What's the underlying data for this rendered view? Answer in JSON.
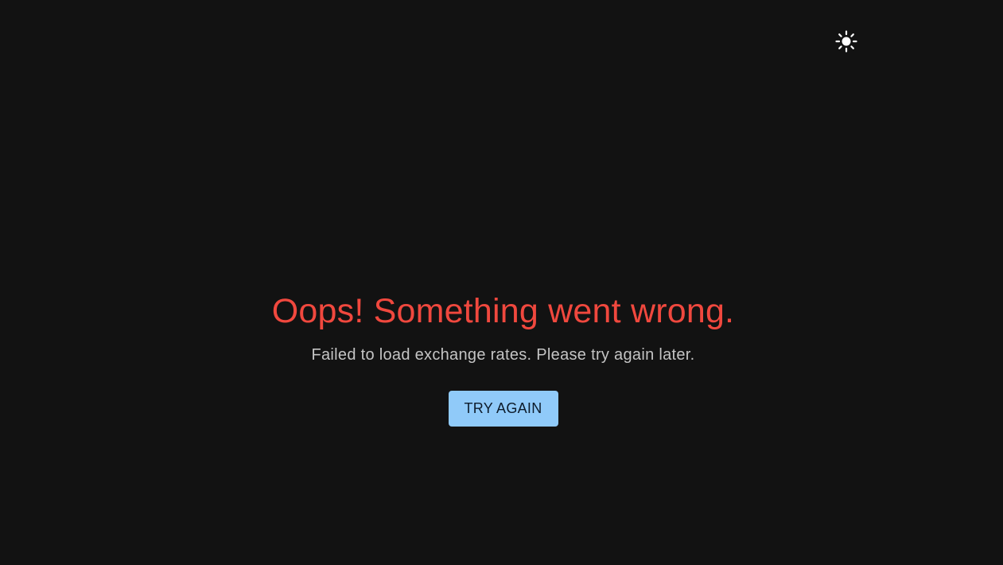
{
  "header": {
    "theme_toggle": {
      "icon": "sun-icon",
      "color": "#ffffff"
    }
  },
  "error": {
    "title": "Oops! Something went wrong.",
    "message": "Failed to load exchange rates. Please try again later.",
    "retry_label": "TRY AGAIN"
  },
  "colors": {
    "background": "#121212",
    "title": "#f0483e",
    "message": "#c4c4c4",
    "button_bg": "#90caf9",
    "button_text": "#0d1b2a"
  }
}
